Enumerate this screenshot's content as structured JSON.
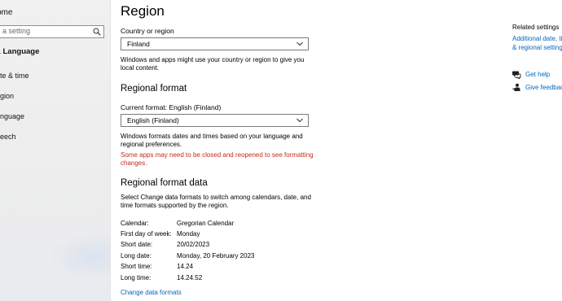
{
  "sidebar": {
    "home": "ome",
    "search_placeholder": "a setting",
    "section": "& Language",
    "items": [
      {
        "label": "ate & time"
      },
      {
        "label": "egion"
      },
      {
        "label": "anguage"
      },
      {
        "label": "peech"
      }
    ]
  },
  "main": {
    "title": "Region",
    "country": {
      "label": "Country or region",
      "value": "Finland",
      "description": "Windows and apps might use your country or region to give you local content."
    },
    "regional_format": {
      "heading": "Regional format",
      "current_label": "Current format: English (Finland)",
      "value": "English (Finland)",
      "description": "Windows formats dates and times based on your language and regional preferences.",
      "warning": "Some apps may need to be closed and reopened to see formatting changes."
    },
    "format_data": {
      "heading": "Regional format data",
      "description": "Select Change data formats to switch among calendars, date, and time formats supported by the region.",
      "rows": [
        {
          "key": "Calendar:",
          "value": "Gregorian Calendar"
        },
        {
          "key": "First day of week:",
          "value": "Monday"
        },
        {
          "key": "Short date:",
          "value": "20/02/2023"
        },
        {
          "key": "Long date:",
          "value": "Monday, 20 February 2023"
        },
        {
          "key": "Short time:",
          "value": "14.24"
        },
        {
          "key": "Long time:",
          "value": "14.24.52"
        }
      ],
      "change_link": "Change data formats"
    }
  },
  "related": {
    "title": "Related settings",
    "link": "Additional date, time, & regional settings",
    "help": "Get help",
    "feedback": "Give feedback"
  },
  "colors": {
    "accent": "#0067c0",
    "warning": "#c42b1c"
  }
}
